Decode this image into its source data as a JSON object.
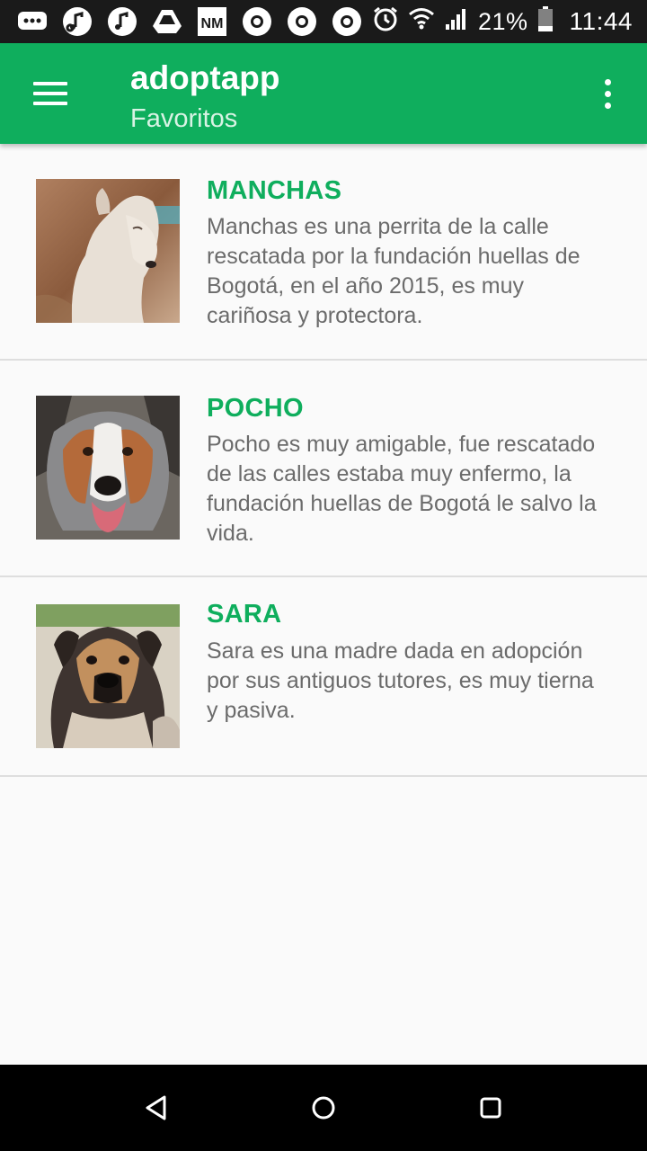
{
  "status_bar": {
    "battery_percent": "21%",
    "time": "11:44",
    "left_icons": [
      "messages-icon",
      "music-app-icon",
      "music-app-icon",
      "drive-icon",
      "nm-app-icon",
      "chrome-icon",
      "chrome-icon",
      "chrome-icon"
    ],
    "nm_label": "NM"
  },
  "app_bar": {
    "title": "adoptapp",
    "subtitle": "Favoritos",
    "color": "#0fae5d"
  },
  "pets": [
    {
      "name": "MANCHAS",
      "description": "Manchas es una perrita de la calle rescatada por la fundación huellas de Bogotá, en el año 2015, es muy cariñosa y protectora."
    },
    {
      "name": "POCHO",
      "description": "Pocho es muy amigable, fue rescatado de las calles estaba muy enfermo, la fundación huellas de Bogotá le salvo la vida."
    },
    {
      "name": "SARA",
      "description": "Sara es una madre dada en adopción por sus antiguos tutores, es muy tierna y pasiva."
    }
  ]
}
